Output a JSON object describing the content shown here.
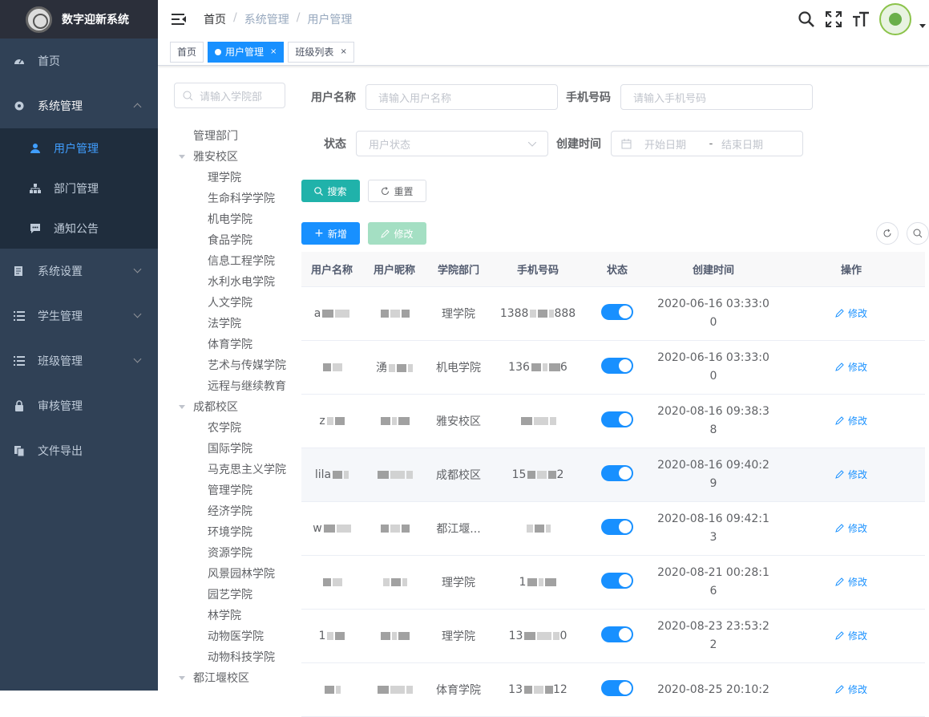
{
  "app": {
    "title": "数字迎新系统"
  },
  "sidebar": {
    "items": [
      {
        "label": "首页",
        "icon": "dashboard-icon"
      },
      {
        "label": "系统管理",
        "icon": "gear-icon",
        "expanded": true,
        "children": [
          {
            "label": "用户管理",
            "icon": "user-icon",
            "active": true
          },
          {
            "label": "部门管理",
            "icon": "tree-icon"
          },
          {
            "label": "通知公告",
            "icon": "message-icon"
          }
        ]
      },
      {
        "label": "系统设置",
        "icon": "settings-doc-icon"
      },
      {
        "label": "学生管理",
        "icon": "list-icon"
      },
      {
        "label": "班级管理",
        "icon": "list-icon"
      },
      {
        "label": "审核管理",
        "icon": "lock-icon"
      },
      {
        "label": "文件导出",
        "icon": "export-icon"
      }
    ]
  },
  "breadcrumb": [
    "首页",
    "系统管理",
    "用户管理"
  ],
  "tabs": [
    {
      "label": "首页",
      "active": false
    },
    {
      "label": "用户管理",
      "active": true,
      "close": "×"
    },
    {
      "label": "班级列表",
      "active": false,
      "close": "×"
    }
  ],
  "tree": {
    "search_placeholder": "请输入学院部",
    "nodes": [
      {
        "label": "管理部门",
        "level": 0,
        "expandable": false
      },
      {
        "label": "雅安校区",
        "level": 0,
        "expandable": true
      },
      {
        "label": "理学院",
        "level": 1
      },
      {
        "label": "生命科学学院",
        "level": 1
      },
      {
        "label": "机电学院",
        "level": 1
      },
      {
        "label": "食品学院",
        "level": 1
      },
      {
        "label": "信息工程学院",
        "level": 1
      },
      {
        "label": "水利水电学院",
        "level": 1
      },
      {
        "label": "人文学院",
        "level": 1
      },
      {
        "label": "法学院",
        "level": 1
      },
      {
        "label": "体育学院",
        "level": 1
      },
      {
        "label": "艺术与传媒学院",
        "level": 1
      },
      {
        "label": "远程与继续教育",
        "level": 1
      },
      {
        "label": "成都校区",
        "level": 0,
        "expandable": true
      },
      {
        "label": "农学院",
        "level": 1
      },
      {
        "label": "国际学院",
        "level": 1
      },
      {
        "label": "马克思主义学院",
        "level": 1
      },
      {
        "label": "管理学院",
        "level": 1
      },
      {
        "label": "经济学院",
        "level": 1
      },
      {
        "label": "环境学院",
        "level": 1
      },
      {
        "label": "资源学院",
        "level": 1
      },
      {
        "label": "风景园林学院",
        "level": 1
      },
      {
        "label": "园艺学院",
        "level": 1
      },
      {
        "label": "林学院",
        "level": 1
      },
      {
        "label": "动物医学院",
        "level": 1
      },
      {
        "label": "动物科技学院",
        "level": 1
      },
      {
        "label": "都江堰校区",
        "level": 0,
        "expandable": true
      }
    ]
  },
  "form": {
    "username_label": "用户名称",
    "username_placeholder": "请输入用户名称",
    "phone_label": "手机号码",
    "phone_placeholder": "请输入手机号码",
    "status_label": "状态",
    "status_placeholder": "用户状态",
    "created_label": "创建时间",
    "start_placeholder": "开始日期",
    "range_sep": "-",
    "end_placeholder": "结束日期"
  },
  "buttons": {
    "search": "搜索",
    "reset": "重置",
    "add": "新增",
    "edit": "修改"
  },
  "table": {
    "columns": [
      "用户名称",
      "用户昵称",
      "学院部门",
      "手机号码",
      "状态",
      "创建时间",
      "操作"
    ],
    "rows": [
      {
        "name": "a",
        "nick": "",
        "dept": "理学院",
        "phone": "1388",
        "phone_end": "888",
        "enabled": true,
        "created": "2020-06-16 03:33:00",
        "action": "修改"
      },
      {
        "name": "",
        "nick": "湧",
        "dept": "机电学院",
        "phone": "136",
        "phone_end": "6",
        "enabled": true,
        "created": "2020-06-16 03:33:00",
        "action": "修改"
      },
      {
        "name": "z",
        "nick": "",
        "dept": "雅安校区",
        "phone": "",
        "phone_end": "",
        "enabled": true,
        "created": "2020-08-16 09:38:38",
        "action": "修改"
      },
      {
        "name": "lila",
        "nick": "",
        "dept": "成都校区",
        "phone": "15",
        "phone_end": "2",
        "enabled": true,
        "created": "2020-08-16 09:40:29",
        "action": "修改"
      },
      {
        "name": "w",
        "nick": "",
        "dept": "都江堰...",
        "phone": "",
        "phone_end": "",
        "enabled": true,
        "created": "2020-08-16 09:42:13",
        "action": "修改"
      },
      {
        "name": "",
        "nick": "",
        "dept": "理学院",
        "phone": "1",
        "phone_end": "",
        "enabled": true,
        "created": "2020-08-21 00:28:16",
        "action": "修改"
      },
      {
        "name": "1",
        "nick": "",
        "dept": "理学院",
        "phone": "13",
        "phone_end": "0",
        "enabled": true,
        "created": "2020-08-23 23:53:22",
        "action": "修改"
      },
      {
        "name": "",
        "nick": "",
        "dept": "体育学院",
        "phone": "13",
        "phone_end": "12",
        "enabled": true,
        "created": "2020-08-25 20:10:2",
        "action": "修改"
      }
    ]
  },
  "colors": {
    "sidebar": "#304156",
    "accent": "#1890ff",
    "teal": "#20b2aa"
  }
}
